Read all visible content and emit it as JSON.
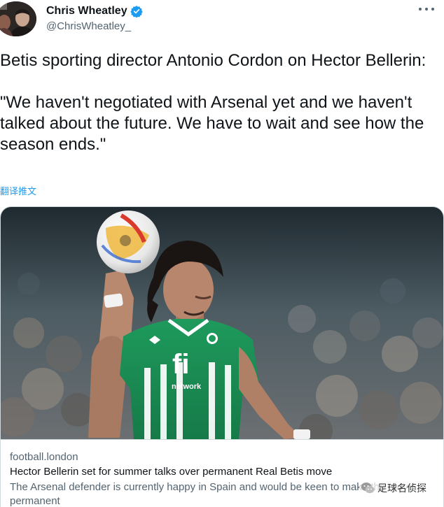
{
  "author": {
    "display_name": "Chris Wheatley",
    "handle": "@ChrisWheatley_",
    "verified": true,
    "verified_color": "#1d9bf0"
  },
  "tweet": {
    "paragraphs": [
      "Betis sporting director Antonio Cordon on Hector Bellerin:",
      "\"We haven't negotiated with Arsenal yet and we haven't talked about the future. We have to wait and see how the season ends.\""
    ],
    "translate_label": "翻译推文"
  },
  "card": {
    "image_alt_icon": "player-holding-ball-photo",
    "domain": "football.london",
    "title": "Hector Bellerin set for summer talks over permanent Real Betis move",
    "description": "The Arsenal defender is currently happy in Spain and would be keen to make the move permanent"
  },
  "watermark": {
    "text": "足球名侦探",
    "icon": "wechat-icon"
  },
  "colors": {
    "text_primary": "#0f1419",
    "text_secondary": "#536471",
    "link": "#1d9bf0",
    "border": "#cfd9de"
  }
}
